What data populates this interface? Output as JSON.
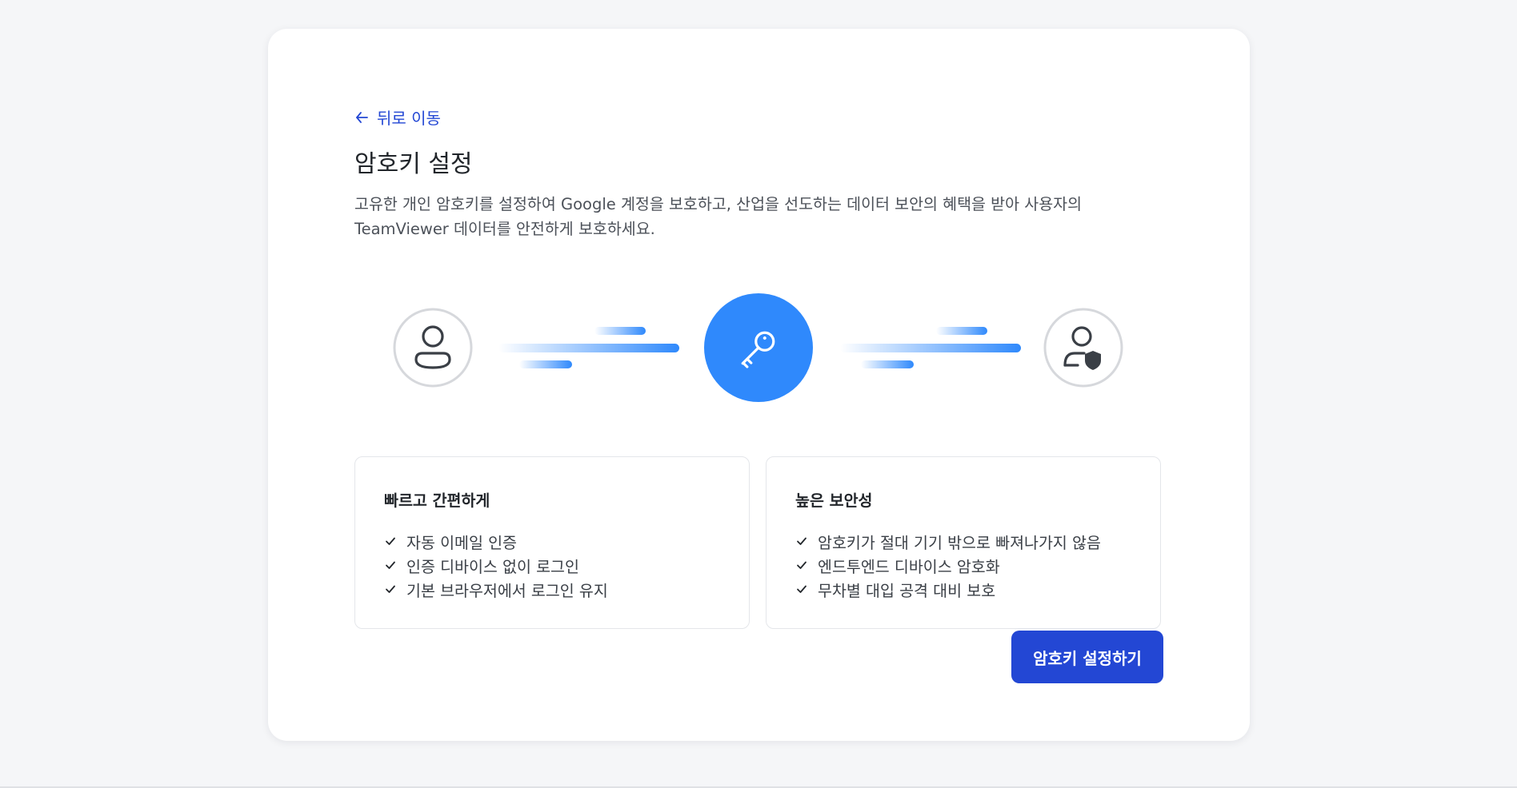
{
  "header": {
    "back_label": "뒤로 이동",
    "title": "암호키 설정",
    "description": "고유한 개인 암호키를 설정하여 Google 계정을 보호하고, 산업을 선도하는 데이터 보안의 혜택을 받아 사용자의 TeamViewer 데이터를 안전하게 보호하세요."
  },
  "illustration": {
    "icons": [
      "user-icon",
      "key-icon",
      "user-shield-icon"
    ],
    "accent_color": "#2f89fc"
  },
  "features": [
    {
      "title": "빠르고 간편하게",
      "items": [
        "자동 이메일 인증",
        "인증 디바이스 없이 로그인",
        "기본 브라우저에서 로그인 유지"
      ]
    },
    {
      "title": "높은 보안성",
      "items": [
        "암호키가 절대 기기 밖으로 빠져나가지 않음",
        "엔드투엔드 디바이스 암호화",
        "무차별 대입 공격 대비 보호"
      ]
    }
  ],
  "actions": {
    "primary_label": "암호키 설정하기",
    "primary_color": "#2347d4"
  }
}
